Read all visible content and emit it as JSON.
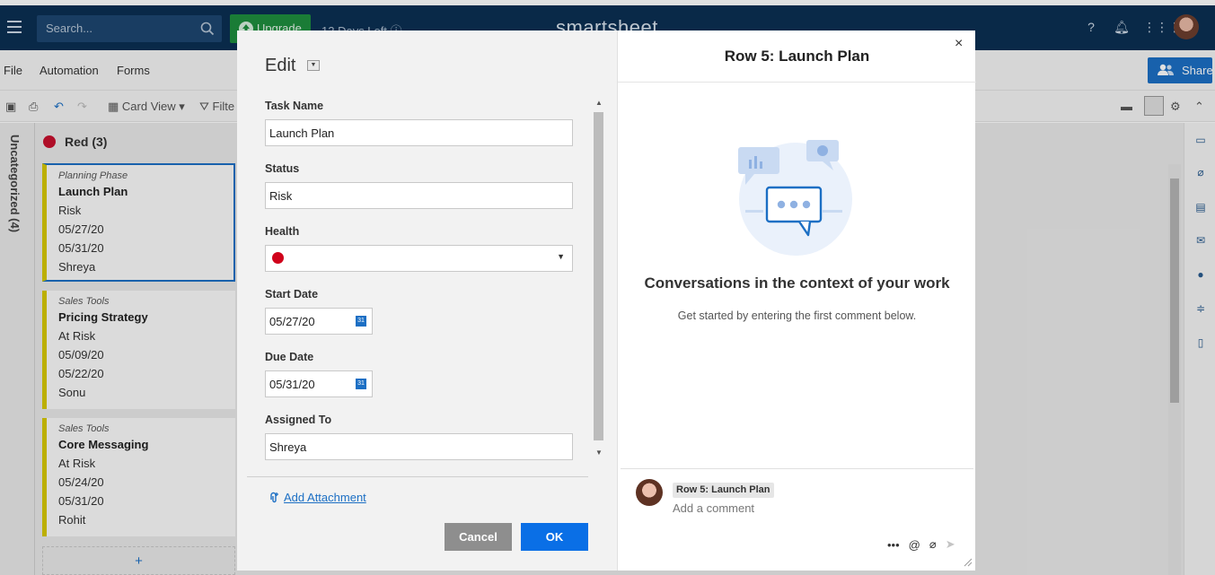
{
  "topbar": {
    "search_placeholder": "Search...",
    "upgrade_label": "Upgrade",
    "days_left": "12 Days Left",
    "brand": "smartsheet",
    "bg_color": "#0b2f52"
  },
  "menu": {
    "items": [
      "File",
      "Automation",
      "Forms"
    ],
    "share_label": "Share"
  },
  "toolbar": {
    "view_label": "Card View",
    "filter_label": "Filte"
  },
  "board": {
    "lane_label": "Uncategorized (4)",
    "column_title": "Red (3)",
    "column_color": "#c8102e",
    "add_label": "+",
    "cards": [
      {
        "category": "Planning Phase",
        "title": "Launch Plan",
        "status": "Risk",
        "start": "05/27/20",
        "due": "05/31/20",
        "assignee": "Shreya"
      },
      {
        "category": "Sales Tools",
        "title": "Pricing Strategy",
        "status": "At Risk",
        "start": "05/09/20",
        "due": "05/22/20",
        "assignee": "Sonu"
      },
      {
        "category": "Sales Tools",
        "title": "Core Messaging",
        "status": "At Risk",
        "start": "05/24/20",
        "due": "05/31/20",
        "assignee": "Rohit"
      }
    ]
  },
  "edit": {
    "title": "Edit",
    "fields": {
      "task_name": {
        "label": "Task Name",
        "value": "Launch Plan"
      },
      "status": {
        "label": "Status",
        "value": "Risk"
      },
      "health": {
        "label": "Health",
        "color": "#d0021b"
      },
      "start_date": {
        "label": "Start Date",
        "value": "05/27/20"
      },
      "due_date": {
        "label": "Due Date",
        "value": "05/31/20"
      },
      "assigned_to": {
        "label": "Assigned To",
        "value": "Shreya"
      }
    },
    "calendar_day": "31",
    "add_attachment": "Add Attachment",
    "cancel": "Cancel",
    "ok": "OK"
  },
  "conversation": {
    "title": "Row 5: Launch Plan",
    "heading": "Conversations in the context of your work",
    "subtext": "Get started by entering the first comment below.",
    "row_chip": "Row 5: Launch Plan",
    "comment_placeholder": "Add a comment",
    "close_glyph": "×"
  }
}
